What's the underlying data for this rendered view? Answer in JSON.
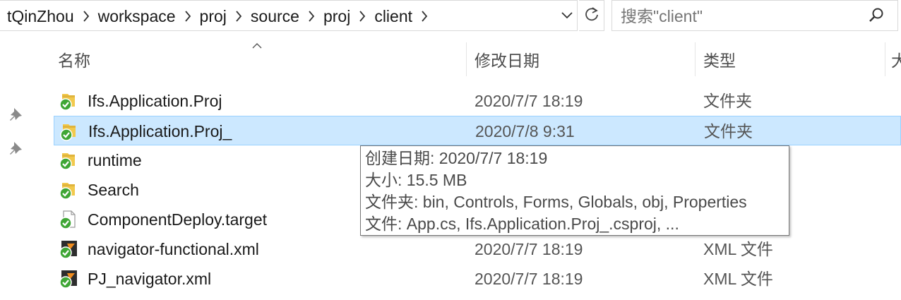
{
  "address": {
    "crumbs": [
      "tQinZhou",
      "workspace",
      "proj",
      "source",
      "proj",
      "client"
    ]
  },
  "search": {
    "placeholder": "搜索\"client\""
  },
  "columns": {
    "name": "名称",
    "date": "修改日期",
    "type": "类型",
    "size": "大"
  },
  "rows": [
    {
      "name": "Ifs.Application.Proj",
      "date": "2020/7/7 18:19",
      "type": "文件夹",
      "icon": "folder-synced-icon"
    },
    {
      "name": "Ifs.Application.Proj_",
      "date": "2020/7/8 9:31",
      "type": "文件夹",
      "icon": "folder-synced-icon"
    },
    {
      "name": "runtime",
      "date": "",
      "type": "",
      "icon": "folder-synced-icon"
    },
    {
      "name": "Search",
      "date": "",
      "type": "",
      "icon": "folder-synced-icon"
    },
    {
      "name": "ComponentDeploy.target",
      "date": "",
      "type": "件",
      "icon": "file-synced-icon"
    },
    {
      "name": "navigator-functional.xml",
      "date": "2020/7/7 18:19",
      "type": "XML 文件",
      "icon": "xml-file-synced-icon"
    },
    {
      "name": "PJ_navigator.xml",
      "date": "2020/7/7 18:19",
      "type": "XML 文件",
      "icon": "xml-file-synced-icon"
    }
  ],
  "tooltip": {
    "created": "创建日期: 2020/7/7 18:19",
    "size": "大小: 15.5 MB",
    "folders": "文件夹: bin, Controls, Forms, Globals, obj, Properties",
    "files": "文件: App.cs, Ifs.Application.Proj_.csproj, ..."
  },
  "colors": {
    "selection": "#cce8ff",
    "selection_border": "#99d1ff",
    "sync_green": "#3fa635"
  }
}
